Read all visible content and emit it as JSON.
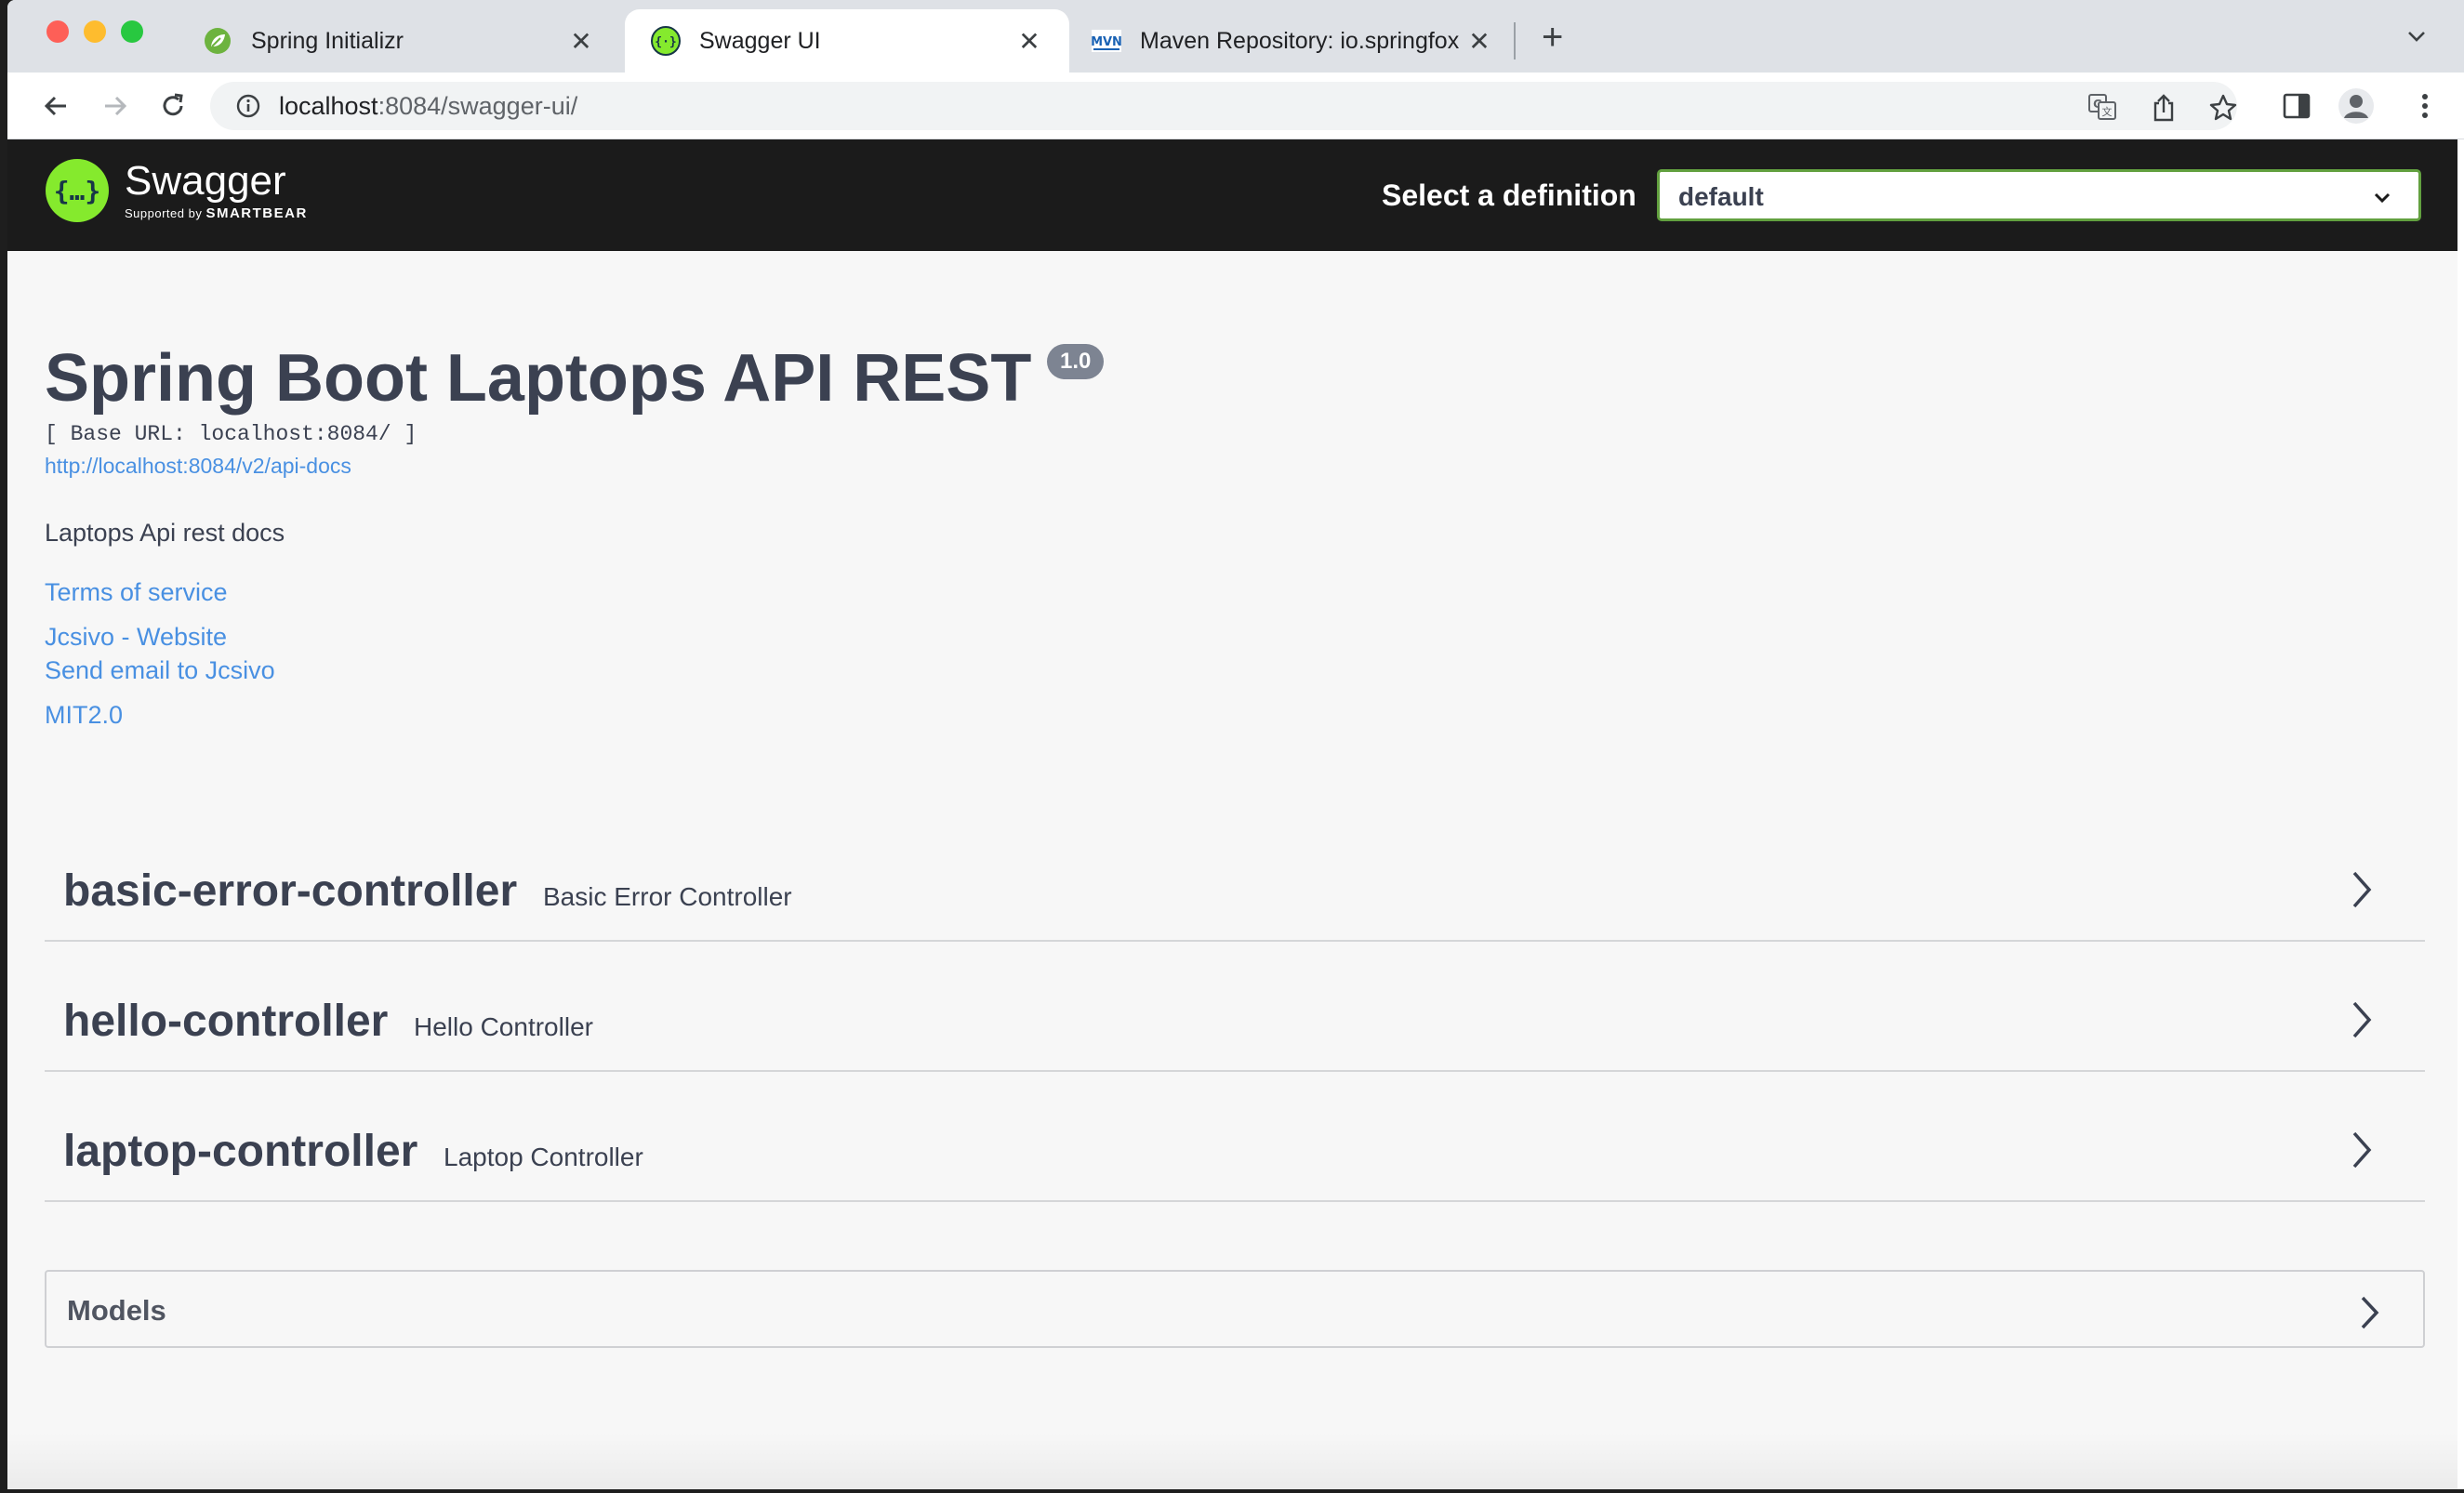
{
  "browser": {
    "tabs": [
      {
        "title": "Spring Initializr",
        "icon": "spring-leaf-icon"
      },
      {
        "title": "Swagger UI",
        "icon": "swagger-icon"
      },
      {
        "title": "Maven Repository: io.springfox",
        "icon": "mvn-icon"
      }
    ],
    "favicon_text": "MVN",
    "close_glyph": "✕",
    "new_tab_glyph": "+",
    "url_host": "localhost",
    "url_rest": ":8084/swagger-ui/"
  },
  "header": {
    "logo_name": "Swagger",
    "logo_sub_prefix": "Supported by",
    "logo_sub_brand": "SMARTBEAR",
    "definition_label": "Select a definition",
    "definition_value": "default",
    "accent": "#62a03f"
  },
  "info": {
    "title": "Spring Boot Laptops API REST",
    "version": "1.0",
    "base_url": "[ Base URL: localhost:8084/ ]",
    "spec_url": "http://localhost:8084/v2/api-docs",
    "description": "Laptops Api rest docs",
    "terms": "Terms of service",
    "website": "Jcsivo - Website",
    "email": "Send email to Jcsivo",
    "license": "MIT2.0",
    "link_color": "#4990e2"
  },
  "controllers": [
    {
      "name": "basic-error-controller",
      "description": "Basic Error Controller"
    },
    {
      "name": "hello-controller",
      "description": "Hello Controller"
    },
    {
      "name": "laptop-controller",
      "description": "Laptop Controller"
    }
  ],
  "models": {
    "label": "Models"
  }
}
